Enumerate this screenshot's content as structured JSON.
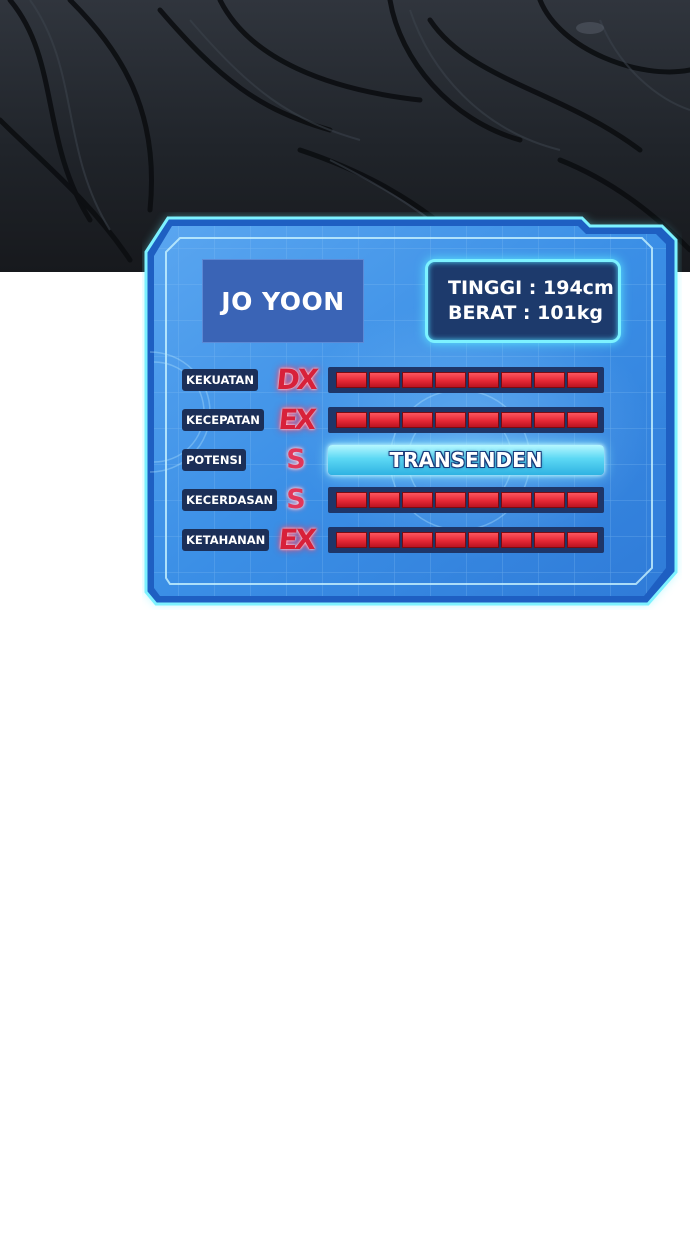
{
  "character": {
    "name": "JO YOON",
    "height_line": "TINGGI : 194cm",
    "weight_line": "BERAT : 101kg"
  },
  "stats": [
    {
      "label": "KEKUATAN",
      "grade": "DX",
      "grade_style": "ex",
      "filled_segments": 8,
      "total_segments": 8
    },
    {
      "label": "KECEPATAN",
      "grade": "EX",
      "grade_style": "ex",
      "filled_segments": 8,
      "total_segments": 8
    },
    {
      "label": "POTENSI",
      "grade": "S",
      "grade_style": "s",
      "bar_text": "TRANSENDEN"
    },
    {
      "label": "KECERDASAN",
      "grade": "S",
      "grade_style": "s",
      "filled_segments": 8,
      "total_segments": 8
    },
    {
      "label": "KETAHANAN",
      "grade": "EX",
      "grade_style": "ex",
      "filled_segments": 8,
      "total_segments": 8
    }
  ],
  "colors": {
    "panel_frame": "#2f7fe6",
    "panel_fill": "#3a8ee8",
    "glow": "#7df2ff",
    "bar_red": "#e52734",
    "grade_red": "#d8213a",
    "top_art_dark": "#20242a"
  }
}
